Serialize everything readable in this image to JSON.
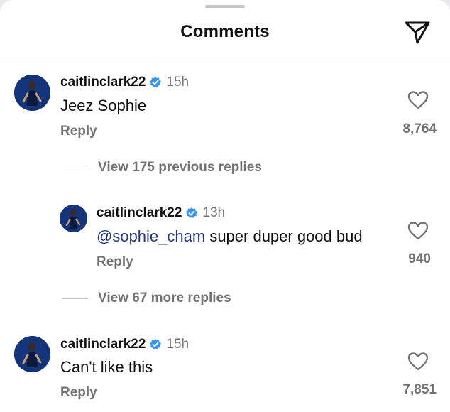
{
  "header": {
    "title": "Comments",
    "share_icon": "paper-plane-icon"
  },
  "comments": [
    {
      "username": "caitlinclark22",
      "time": "15h",
      "text": "Jeez Sophie",
      "reply_label": "Reply",
      "likes": "8,764"
    },
    {
      "username": "caitlinclark22",
      "time": "15h",
      "text": "Can't like this",
      "reply_label": "Reply",
      "likes": "7,851"
    }
  ],
  "thread": {
    "previous_replies_label": "View 175 previous replies",
    "more_replies_label": "View 67 more replies",
    "reply": {
      "username": "caitlinclark22",
      "time": "13h",
      "mention": "@sophie_cham",
      "text": " super duper good bud",
      "reply_label": "Reply",
      "likes": "940"
    }
  },
  "colors": {
    "verified": "#3897f0",
    "mention": "#24387a",
    "secondary_text": "#737373",
    "avatar_bg": "#15357a"
  }
}
